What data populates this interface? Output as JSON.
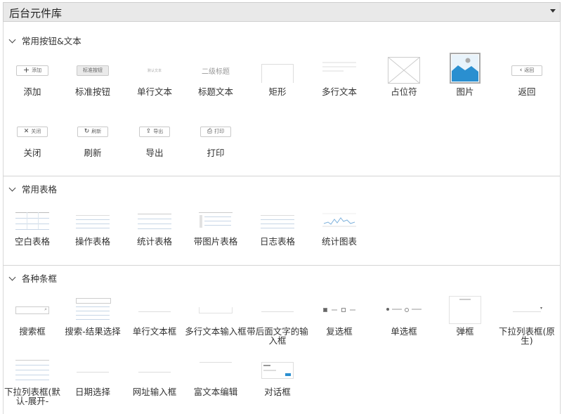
{
  "topbar": {
    "title": "后台元件库"
  },
  "sections": [
    {
      "title": "常用按钮&文本",
      "items": [
        {
          "label": "添加",
          "icon_text": "添加"
        },
        {
          "label": "标准按钮",
          "icon_text": "标准按钮"
        },
        {
          "label": "单行文本",
          "icon_text": "默认文本"
        },
        {
          "label": "标题文本",
          "icon_text": "二级标题"
        },
        {
          "label": "矩形"
        },
        {
          "label": "多行文本"
        },
        {
          "label": "占位符"
        },
        {
          "label": "图片"
        },
        {
          "label": "返回",
          "icon_text": "返回"
        },
        {
          "label": "关闭",
          "icon_text": "关闭"
        },
        {
          "label": "刷新",
          "icon_text": "刷新"
        },
        {
          "label": "导出",
          "icon_text": "导出"
        },
        {
          "label": "打印",
          "icon_text": "打印"
        }
      ]
    },
    {
      "title": "常用表格",
      "items": [
        {
          "label": "空白表格"
        },
        {
          "label": "操作表格"
        },
        {
          "label": "统计表格"
        },
        {
          "label": "带图片表格"
        },
        {
          "label": "日志表格"
        },
        {
          "label": "统计图表"
        }
      ]
    },
    {
      "title": "各种条框",
      "items": [
        {
          "label": "搜索框"
        },
        {
          "label": "搜索-结果选择"
        },
        {
          "label": "单行文本框"
        },
        {
          "label": "多行文本输入框"
        },
        {
          "label": "带后面文字的输入框"
        },
        {
          "label": "复选框"
        },
        {
          "label": "单选框"
        },
        {
          "label": "弹框"
        },
        {
          "label": "下拉列表框(原生)"
        },
        {
          "label": "下拉列表框(默认-展开-"
        },
        {
          "label": "日期选择"
        },
        {
          "label": "网址输入框"
        },
        {
          "label": "富文本编辑"
        },
        {
          "label": "对话框"
        }
      ]
    }
  ],
  "colors": {
    "image_blue": "#2a8fd0",
    "header_bg": "#e9e9e9"
  }
}
